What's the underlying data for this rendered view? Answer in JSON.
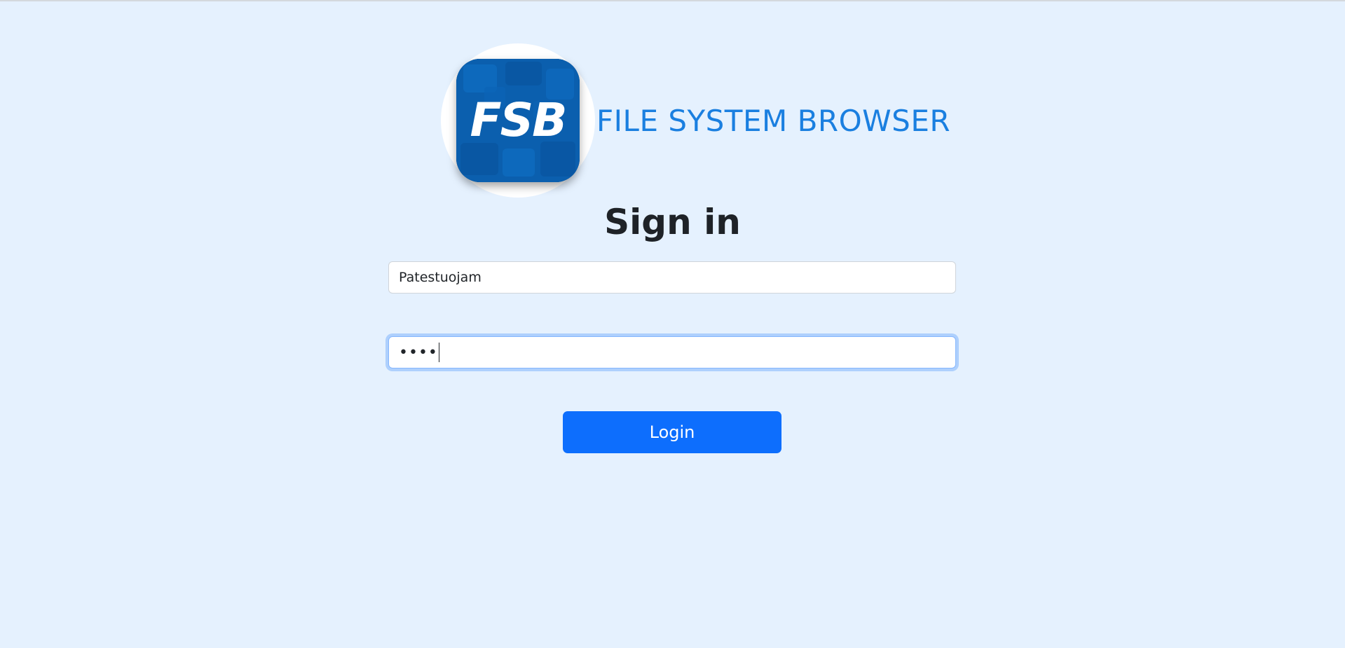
{
  "app": {
    "logo_text": "FSB",
    "title": "FILE SYSTEM BROWSER"
  },
  "form": {
    "heading": "Sign in",
    "username_value": "Patestuojam",
    "password_mask": "••••",
    "login_label": "Login"
  },
  "colors": {
    "page_background": "#e5f1fe",
    "brand_title": "#1a7fe0",
    "login_button": "#0d6efd",
    "logo_tile": "#0a5aa8"
  }
}
